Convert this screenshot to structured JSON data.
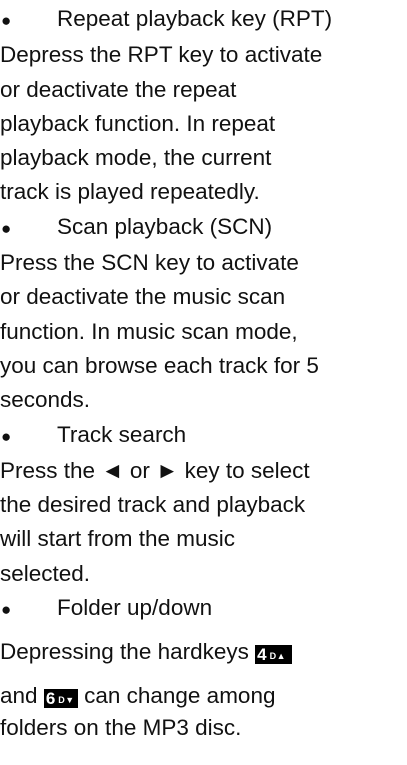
{
  "sections": [
    {
      "heading": "Repeat playback key (RPT)",
      "lines": [
        "Depress the RPT key to activate",
        "or deactivate the repeat",
        "playback function. In repeat",
        "playback mode, the current",
        "track is played repeatedly."
      ]
    },
    {
      "heading": "Scan playback (SCN)",
      "lines": [
        "Press the SCN key to activate",
        "or deactivate the music scan",
        "function. In music scan mode,",
        "you can browse each track for 5",
        "seconds."
      ]
    },
    {
      "heading": "Track search",
      "lines": [
        "Press the ◄ or ► key to select",
        "the desired track and playback",
        "will start from the music",
        "selected."
      ]
    },
    {
      "heading": "Folder up/down",
      "line1_text": "Depressing the hardkeys",
      "key1": {
        "number": "4",
        "label": "D▲"
      },
      "line2_prefix": "and",
      "key2": {
        "number": "6",
        "label": "D▼"
      },
      "line2_suffix": "can change among",
      "line3": "folders on the MP3 disc."
    }
  ],
  "bullet_glyph": "●"
}
